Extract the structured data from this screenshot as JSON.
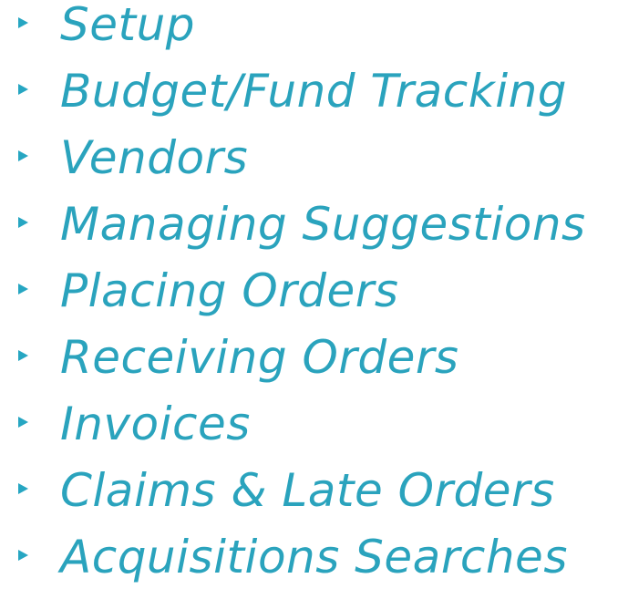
{
  "colors": {
    "text": "#2aa3bd",
    "bullet": "#26a6c2",
    "background": "#ffffff"
  },
  "items": [
    {
      "label": "Setup"
    },
    {
      "label": "Budget/Fund Tracking"
    },
    {
      "label": "Vendors"
    },
    {
      "label": "Managing Suggestions"
    },
    {
      "label": "Placing Orders"
    },
    {
      "label": "Receiving Orders"
    },
    {
      "label": "Invoices"
    },
    {
      "label": "Claims & Late Orders"
    },
    {
      "label": "Acquisitions Searches"
    }
  ]
}
